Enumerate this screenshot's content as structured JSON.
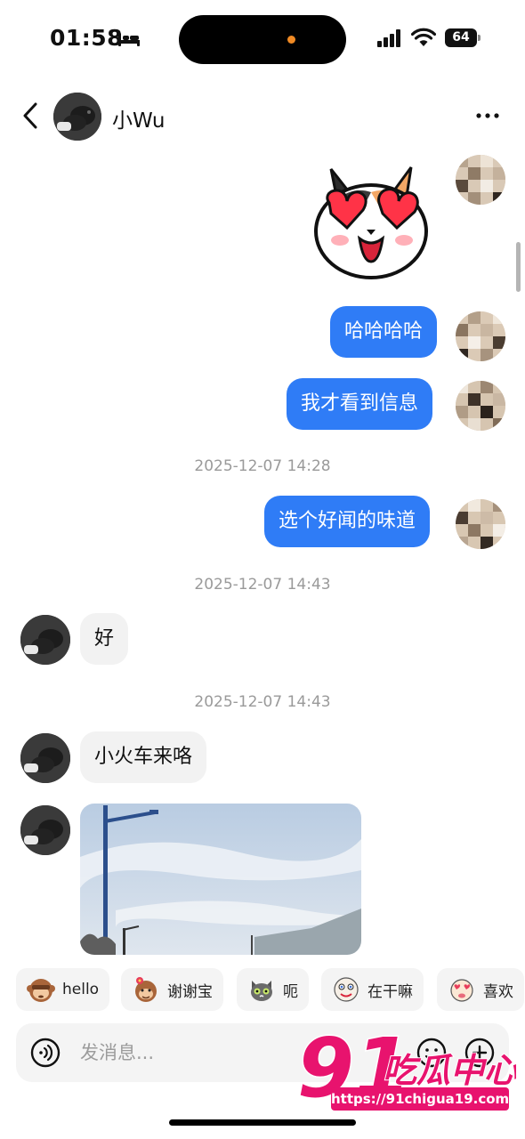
{
  "status_bar": {
    "time": "01:58",
    "battery": "64"
  },
  "header": {
    "contact_name": "小Wu"
  },
  "messages": {
    "m1_text": "哈哈哈哈",
    "m2_text": "我才看到信息",
    "ts1": "2025-12-07 14:28",
    "m3_text": "选个好闻的味道",
    "ts2": "2025-12-07 14:43",
    "m4_text": "好",
    "ts3": "2025-12-07 14:43",
    "m5_text": "小火车来咯"
  },
  "quick_replies": [
    {
      "label": "hello",
      "icon": "monkey-emoji-icon"
    },
    {
      "label": "谢谢宝",
      "icon": "monkey-flower-emoji-icon"
    },
    {
      "label": "呃",
      "icon": "cat-emoji-icon"
    },
    {
      "label": "在干嘛",
      "icon": "cartoon-emoji-icon"
    },
    {
      "label": "喜欢",
      "icon": "cartoon-love-emoji-icon"
    }
  ],
  "input": {
    "placeholder": "发消息..."
  },
  "watermark": {
    "number": "91",
    "text": "吃瓜中心",
    "url": "https://91chigua19.com"
  },
  "colors": {
    "my_bubble": "#2f7cf6",
    "their_bubble": "#f2f2f2",
    "timestamp": "#9a9a9a",
    "watermark": "#e8136e"
  }
}
